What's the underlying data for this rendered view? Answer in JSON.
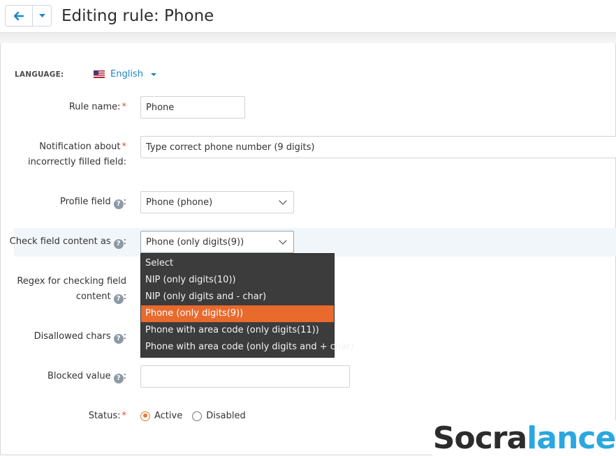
{
  "header": {
    "title": "Editing rule: Phone"
  },
  "language": {
    "label": "LANGUAGE:",
    "value": "English"
  },
  "form": {
    "rule_name": {
      "label": "Rule name:",
      "value": "Phone"
    },
    "notification": {
      "label_line1": "Notification about",
      "label_line2": "incorrectly filled field:",
      "value": "Type correct phone number (9 digits)"
    },
    "profile_field": {
      "label": "Profile field",
      "value": "Phone (phone)"
    },
    "check_content": {
      "label": "Check field content as",
      "value": "Phone (only digits(9))",
      "options": [
        "Select",
        "NIP (only digits(10))",
        "NIP (only digits and - char)",
        "Phone (only digits(9))",
        "Phone with area code (only digits(11))",
        "Phone with area code (only digits and + char)"
      ],
      "selected_index": 3
    },
    "regex": {
      "label_line1": "Regex for checking field",
      "label_line2": "content"
    },
    "disallowed_chars": {
      "label": "Disallowed chars"
    },
    "blocked_value": {
      "label": "Blocked value",
      "value": ""
    },
    "status": {
      "label": "Status:",
      "options": [
        "Active",
        "Disabled"
      ],
      "selected": "Active"
    }
  },
  "watermark": {
    "part1": "Socra",
    "part2": "lance"
  },
  "colors": {
    "accent": "#e96a2d",
    "link": "#1a86c8",
    "dropdown_bg": "#3c3c3c"
  }
}
